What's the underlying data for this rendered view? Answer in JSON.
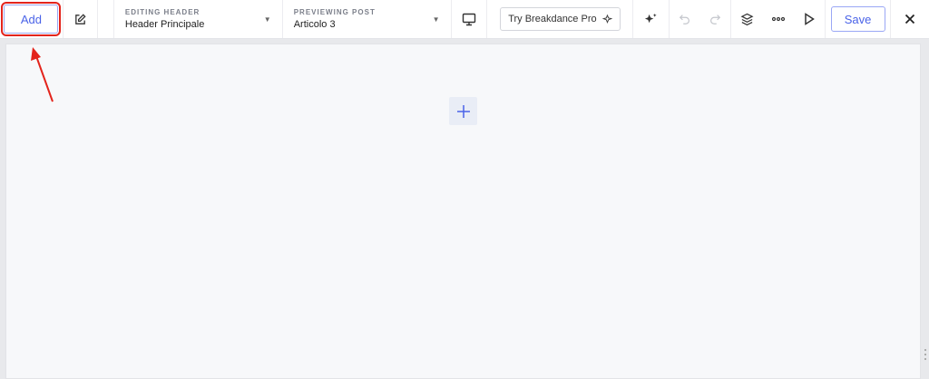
{
  "toolbar": {
    "add_label": "Add",
    "editing": {
      "label": "EDITING HEADER",
      "value": "Header Principale"
    },
    "previewing": {
      "label": "PREVIEWING POST",
      "value": "Articolo 3"
    },
    "pro_label": "Try Breakdance Pro",
    "save_label": "Save"
  },
  "colors": {
    "accent": "#4a63e8",
    "annotation": "#e3241c",
    "canvas_bg": "#f7f8fa"
  },
  "icons": [
    "edit-icon",
    "chevron-down-icon",
    "desktop-icon",
    "sparkle-icon",
    "ai-sparkle-icon",
    "undo-icon",
    "redo-icon",
    "layers-icon",
    "more-icon",
    "play-icon",
    "close-icon",
    "plus-icon"
  ]
}
